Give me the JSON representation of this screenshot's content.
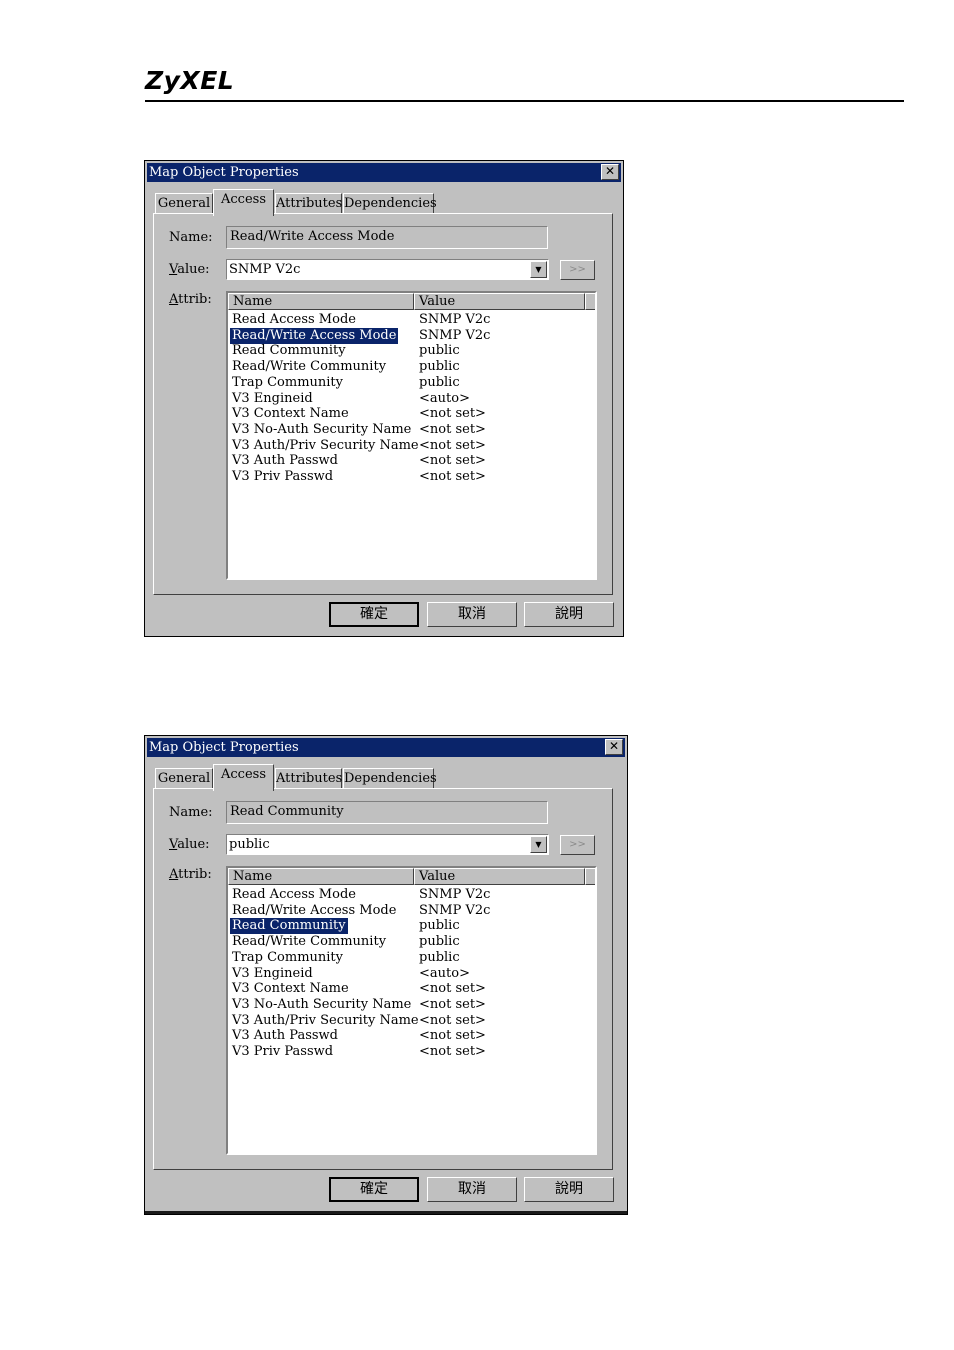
{
  "header": {
    "logo": "ZyXEL"
  },
  "dialogs": [
    {
      "title": "Map Object Properties",
      "tabs": [
        "General",
        "Access",
        "Attributes",
        "Dependencies"
      ],
      "active_tab": "Access",
      "name_label": "Name:",
      "name_value": "Read/Write Access Mode",
      "value_label_key": "V",
      "value_label_rest": "alue:",
      "value_value": "SNMP V2c",
      "more_button": ">>",
      "attrib_label_key": "A",
      "attrib_label_rest": "ttrib:",
      "columns": [
        "Name",
        "Value"
      ],
      "rows": [
        {
          "name": "Read Access Mode",
          "value": "SNMP V2c"
        },
        {
          "name": "Read/Write Access Mode",
          "value": "SNMP V2c",
          "selected": true
        },
        {
          "name": "Read Community",
          "value": "public"
        },
        {
          "name": "Read/Write Community",
          "value": "public"
        },
        {
          "name": "Trap Community",
          "value": "public"
        },
        {
          "name": "V3 Engineid",
          "value": "<auto>"
        },
        {
          "name": "V3 Context Name",
          "value": "<not set>"
        },
        {
          "name": "V3 No-Auth Security Name",
          "value": "<not set>"
        },
        {
          "name": "V3 Auth/Priv Security Name",
          "value": "<not set>"
        },
        {
          "name": "V3 Auth Passwd",
          "value": "<not set>"
        },
        {
          "name": "V3 Priv Passwd",
          "value": "<not set>"
        }
      ],
      "buttons": {
        "ok": "確定",
        "cancel": "取消",
        "help": "說明"
      }
    },
    {
      "title": "Map Object Properties",
      "tabs": [
        "General",
        "Access",
        "Attributes",
        "Dependencies"
      ],
      "active_tab": "Access",
      "name_label": "Name:",
      "name_value": "Read Community",
      "value_label_key": "V",
      "value_label_rest": "alue:",
      "value_value": "public",
      "more_button": ">>",
      "attrib_label_key": "A",
      "attrib_label_rest": "ttrib:",
      "columns": [
        "Name",
        "Value"
      ],
      "rows": [
        {
          "name": "Read Access Mode",
          "value": "SNMP V2c"
        },
        {
          "name": "Read/Write Access Mode",
          "value": "SNMP V2c"
        },
        {
          "name": "Read Community",
          "value": "public",
          "selected": true
        },
        {
          "name": "Read/Write Community",
          "value": "public"
        },
        {
          "name": "Trap Community",
          "value": "public"
        },
        {
          "name": "V3 Engineid",
          "value": "<auto>"
        },
        {
          "name": "V3 Context Name",
          "value": "<not set>"
        },
        {
          "name": "V3 No-Auth Security Name",
          "value": "<not set>"
        },
        {
          "name": "V3 Auth/Priv Security Name",
          "value": "<not set>"
        },
        {
          "name": "V3 Auth Passwd",
          "value": "<not set>"
        },
        {
          "name": "V3 Priv Passwd",
          "value": "<not set>"
        }
      ],
      "buttons": {
        "ok": "確定",
        "cancel": "取消",
        "help": "說明"
      }
    }
  ]
}
